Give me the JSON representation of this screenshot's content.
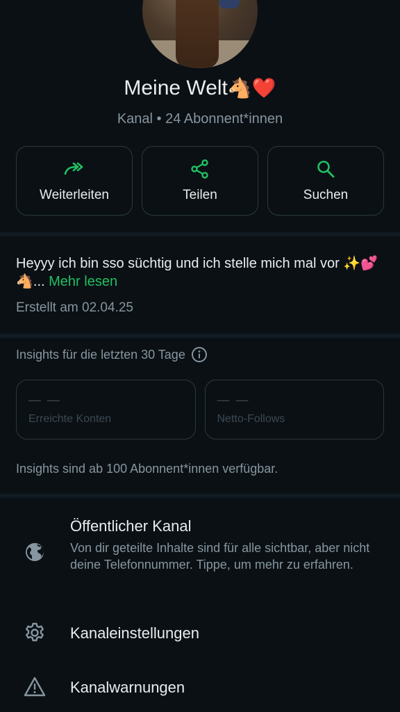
{
  "channel": {
    "name": "Meine Welt",
    "name_emoji": "🐴❤️",
    "subtitle": "Kanal • 24 Abonnent*innen"
  },
  "actions": [
    {
      "label": "Weiterleiten",
      "icon": "forward-icon"
    },
    {
      "label": "Teilen",
      "icon": "share-icon"
    },
    {
      "label": "Suchen",
      "icon": "search-icon"
    }
  ],
  "description": {
    "text": "Heyyy ich bin sso süchtig und ich stelle mich mal vor ✨💕🐴...",
    "more_label": "Mehr lesen",
    "created": "Erstellt am 02.04.25"
  },
  "insights": {
    "title": "Insights für die letzten 30 Tage",
    "cards": [
      {
        "value": "— —",
        "label": "Erreichte Konten"
      },
      {
        "value": "— —",
        "label": "Netto-Follows"
      }
    ],
    "note": "Insights sind ab 100 Abonnent*innen verfügbar."
  },
  "settings": [
    {
      "icon": "globe-icon",
      "title": "Öffentlicher Kanal",
      "text": "Von dir geteilte Inhalte sind für alle sichtbar, aber nicht deine Telefonnummer. Tippe, um mehr zu erfahren."
    },
    {
      "icon": "gear-icon",
      "title": "Kanaleinstellungen"
    },
    {
      "icon": "warning-icon",
      "title": "Kanalwarnungen"
    }
  ],
  "colors": {
    "accent": "#21c063",
    "background": "#0b1014",
    "muted_text": "#8696a0"
  }
}
